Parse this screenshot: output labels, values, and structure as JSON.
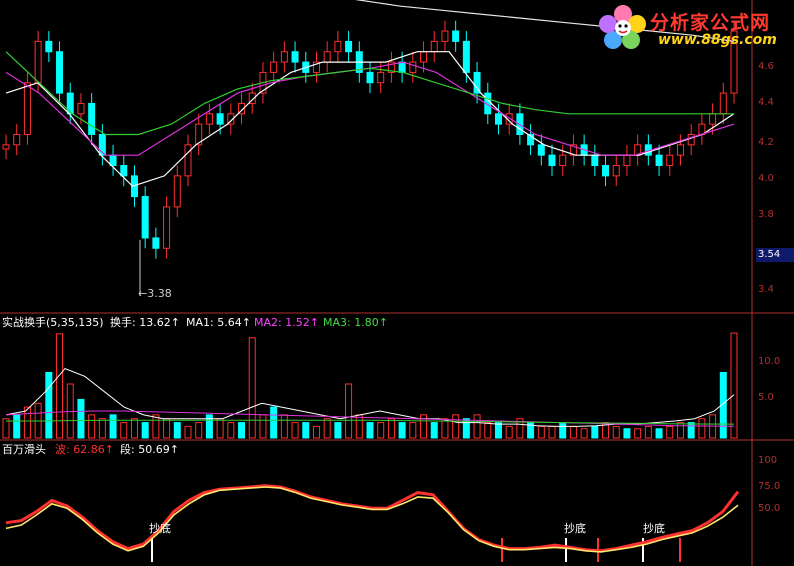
{
  "logo": {
    "title": "分析家公式网",
    "url": "www.88gs.com"
  },
  "price_badge": "3.54",
  "low_marker": "←3.38",
  "panel1": {
    "ticks": [
      "4.6",
      "4.4",
      "4.2",
      "4.0",
      "3.8",
      "3.4"
    ]
  },
  "panel2": {
    "name": "实战换手(5,35,135)",
    "items": [
      {
        "label": "换手: 13.62↑",
        "color": "#ffffff"
      },
      {
        "label": "MA1: 5.64↑",
        "color": "#ffffff"
      },
      {
        "label": "MA2: 1.52↑",
        "color": "#ff44ff"
      },
      {
        "label": "MA3: 1.80↑",
        "color": "#44dd44"
      }
    ],
    "ticks": [
      "10.0",
      "5.0"
    ]
  },
  "panel3": {
    "name": "百万滑头",
    "items": [
      {
        "label": "波: 62.86↑",
        "color": "#ff3030"
      },
      {
        "label": "段: 50.69↑",
        "color": "#ffffff"
      }
    ],
    "ticks": [
      "100",
      "75.0",
      "50.0"
    ],
    "signals": [
      "抄底",
      "抄底",
      "抄底"
    ]
  },
  "colors": {
    "up": "#ff3030",
    "down": "#00ffff",
    "ma_white": "#ffffff",
    "ma_magenta": "#dd33dd",
    "ma_green": "#33cc33",
    "long_line": "#e6e6e6",
    "axis": "#b03030"
  },
  "chart_data": [
    {
      "type": "candlestick",
      "title": "",
      "xlabel": "",
      "ylabel": "",
      "ylim": [
        3.3,
        4.75
      ],
      "close_series_approx": [
        4.05,
        4.1,
        4.35,
        4.55,
        4.5,
        4.3,
        4.2,
        4.25,
        4.1,
        4.0,
        3.95,
        3.9,
        3.8,
        3.6,
        3.55,
        3.75,
        3.9,
        4.05,
        4.15,
        4.2,
        4.15,
        4.2,
        4.25,
        4.3,
        4.4,
        4.45,
        4.5,
        4.45,
        4.4,
        4.45,
        4.5,
        4.55,
        4.5,
        4.4,
        4.35,
        4.4,
        4.45,
        4.4,
        4.45,
        4.5,
        4.55,
        4.6,
        4.55,
        4.4,
        4.3,
        4.2,
        4.15,
        4.2,
        4.1,
        4.05,
        4.0,
        3.95,
        4.0,
        4.05,
        4.0,
        3.95,
        3.9,
        3.95,
        4.0,
        4.05,
        4.0,
        3.95,
        4.0,
        4.05,
        4.1,
        4.15,
        4.2,
        4.3,
        4.6
      ],
      "series": [
        {
          "values": [
            4.3,
            4.35,
            4.2,
            4.0,
            3.85,
            3.9,
            4.05,
            4.15,
            4.3,
            4.4,
            4.45,
            4.45,
            4.45,
            4.5,
            4.5,
            4.3,
            4.15,
            4.05,
            4.0,
            4.0,
            4.0,
            4.05,
            4.1,
            4.2
          ]
        },
        {
          "values": [
            4.4,
            4.3,
            4.15,
            4.0,
            4.0,
            4.1,
            4.2,
            4.3,
            4.35,
            4.38,
            4.4,
            4.42,
            4.45,
            4.4,
            4.3,
            4.2,
            4.1,
            4.05,
            4.0,
            4.0,
            4.05,
            4.1,
            4.15
          ]
        },
        {
          "values": [
            4.5,
            4.35,
            4.2,
            4.1,
            4.1,
            4.15,
            4.25,
            4.32,
            4.36,
            4.38,
            4.4,
            4.42,
            4.4,
            4.35,
            4.3,
            4.25,
            4.22,
            4.2,
            4.2,
            4.2,
            4.2,
            4.2,
            4.2
          ]
        },
        {
          "values": [
            4.85,
            4.82,
            4.78,
            4.75,
            4.72,
            4.7,
            4.68,
            4.66,
            4.64,
            4.62,
            4.6,
            4.58,
            4.55
          ]
        }
      ],
      "annotations": [
        "←3.38",
        "3.54"
      ],
      "grid": false
    },
    {
      "type": "bar",
      "title": "实战换手(5,35,135)",
      "ylim": [
        0,
        14
      ],
      "values_approx": [
        2.5,
        3,
        4,
        4.5,
        8.5,
        13.5,
        7,
        5,
        3,
        2.5,
        3,
        2,
        2.5,
        2,
        3,
        2.5,
        2,
        1.5,
        2,
        3,
        2.5,
        2,
        2,
        13,
        3,
        4,
        3,
        2,
        2,
        1.5,
        2.5,
        2,
        7,
        3,
        2,
        2,
        2.5,
        2,
        2,
        3,
        2,
        2.5,
        3,
        2.5,
        3,
        2,
        2,
        1.5,
        2.5,
        2,
        1.5,
        1.5,
        2,
        1.5,
        1.2,
        1.5,
        2,
        1.5,
        1.2,
        1.2,
        1.5,
        1.2,
        1.5,
        2,
        2,
        2.5,
        3,
        8.5,
        13.6
      ],
      "series": [
        {
          "name": "MA1",
          "values": [
            3,
            3.5,
            6,
            9,
            8,
            6,
            4,
            3,
            2.5,
            2.5,
            2.5,
            2.5,
            3.5,
            4.5,
            4,
            3.5,
            3,
            2.5,
            3,
            3.5,
            3,
            2.5,
            2.5,
            2,
            2,
            1.8,
            1.8,
            1.6,
            1.5,
            1.5,
            1.6,
            1.8,
            1.8,
            2,
            2.2,
            2.5,
            3.5,
            5.6
          ]
        },
        {
          "name": "MA2",
          "values": [
            3,
            3.2,
            3.4,
            3.5,
            3.5,
            3.4,
            3.3,
            3.2,
            3.1,
            3.0,
            2.9,
            2.8,
            2.7,
            2.6,
            2.5,
            2.4,
            2.3,
            2.2,
            2.1,
            2.0,
            1.9,
            1.8,
            1.7,
            1.6,
            1.55,
            1.52
          ]
        },
        {
          "name": "MA3",
          "values": [
            2.2,
            2.2,
            2.25,
            2.3,
            2.3,
            2.3,
            2.3,
            2.3,
            2.3,
            2.3,
            2.3,
            2.3,
            2.25,
            2.2,
            2.15,
            2.1,
            2.05,
            2.0,
            1.95,
            1.9,
            1.85,
            1.82,
            1.8
          ]
        }
      ]
    },
    {
      "type": "line",
      "title": "百万滑头",
      "ylim": [
        0,
        100
      ],
      "series": [
        {
          "name": "波",
          "values": [
            35,
            37,
            45,
            55,
            50,
            40,
            28,
            18,
            12,
            16,
            28,
            45,
            55,
            62,
            65,
            66,
            67,
            68,
            67,
            63,
            58,
            55,
            52,
            50,
            48,
            48,
            55,
            62,
            60,
            45,
            30,
            20,
            15,
            12,
            12,
            13,
            15,
            13,
            11,
            10,
            12,
            15,
            18,
            22,
            25,
            28,
            35,
            45,
            62.86
          ]
        },
        {
          "name": "段",
          "values": [
            30,
            33,
            42,
            52,
            48,
            38,
            26,
            16,
            10,
            14,
            26,
            42,
            52,
            60,
            64,
            65,
            66,
            67,
            66,
            62,
            57,
            54,
            51,
            49,
            47,
            47,
            52,
            58,
            57,
            44,
            29,
            19,
            14,
            11,
            11,
            12,
            13,
            12,
            10,
            9,
            11,
            13,
            16,
            20,
            23,
            26,
            32,
            40,
            50.69
          ]
        }
      ],
      "annotations": [
        "抄底",
        "抄底",
        "抄底"
      ]
    }
  ]
}
